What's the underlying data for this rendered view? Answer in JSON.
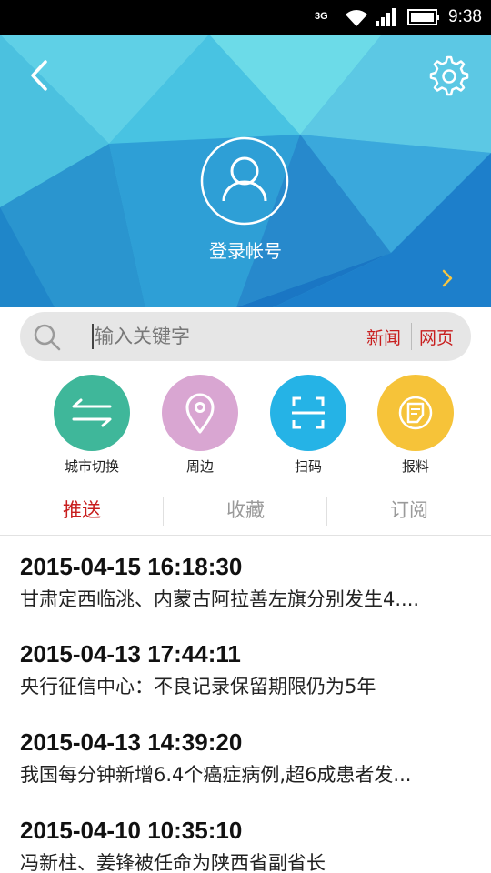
{
  "status_bar": {
    "network": "3G",
    "time": "9:38"
  },
  "header": {
    "login_label": "登录帐号"
  },
  "search": {
    "placeholder": "输入关键字",
    "option_news": "新闻",
    "option_web": "网页"
  },
  "actions": [
    {
      "label": "城市切换",
      "color": "#3fb79a",
      "icon": "swap-arrows-icon"
    },
    {
      "label": "周边",
      "color": "#d9a6d2",
      "icon": "location-pin-icon"
    },
    {
      "label": "扫码",
      "color": "#25b3e6",
      "icon": "scan-icon"
    },
    {
      "label": "报料",
      "color": "#f6c339",
      "icon": "report-icon"
    }
  ],
  "tabs": [
    {
      "label": "推送",
      "active": true
    },
    {
      "label": "收藏",
      "active": false
    },
    {
      "label": "订阅",
      "active": false
    }
  ],
  "feed": [
    {
      "timestamp": "2015-04-15 16:18:30",
      "title": "甘肃定西临洮、内蒙古阿拉善左旗分别发生4...."
    },
    {
      "timestamp": "2015-04-13 17:44:11",
      "title": "央行征信中心：不良记录保留期限仍为5年"
    },
    {
      "timestamp": "2015-04-13 14:39:20",
      "title": "我国每分钟新增6.4个癌症病例,超6成患者发..."
    },
    {
      "timestamp": "2015-04-10 10:35:10",
      "title": "冯新柱、姜锋被任命为陕西省副省长"
    }
  ],
  "colors": {
    "accent_red": "#c81e1e",
    "banner_light": "#6fd6e6",
    "banner_dark": "#1e7fd0"
  }
}
